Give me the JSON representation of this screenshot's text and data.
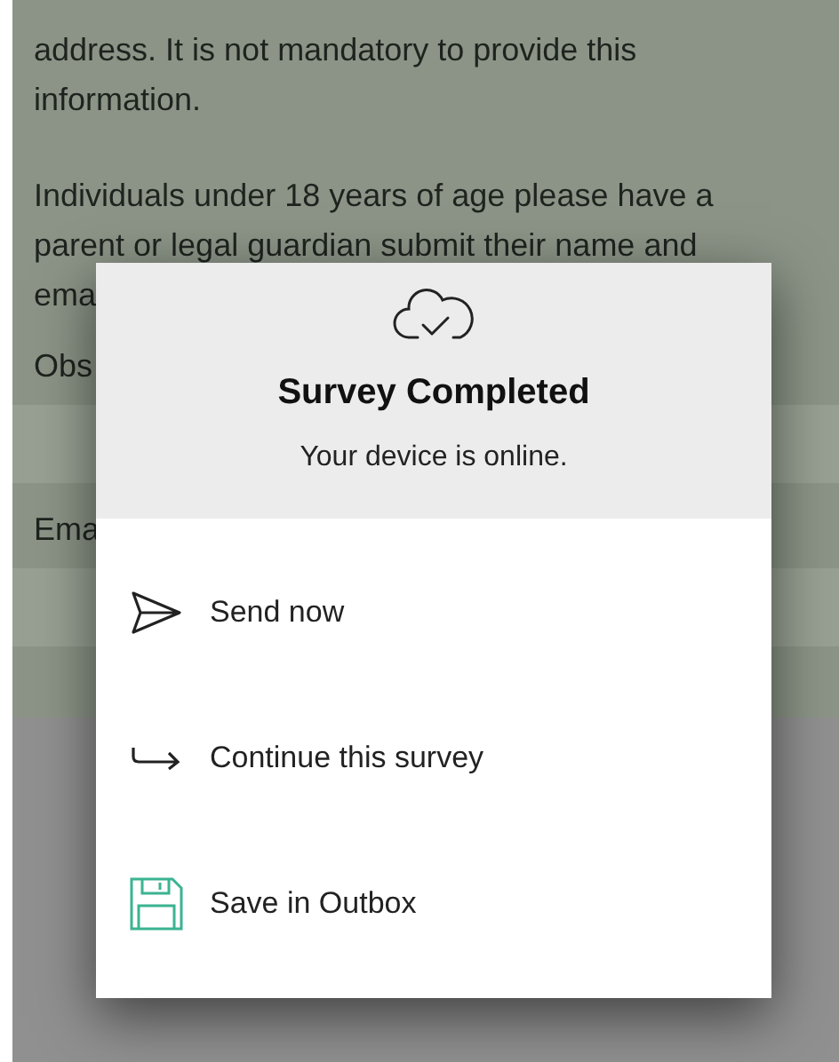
{
  "form_text": {
    "paragraphs": [
      [
        "address. It is not mandatory to provide this",
        "information."
      ],
      [
        "Individuals under 18 years of age please have a",
        "parent or legal guardian submit their name and",
        "ema"
      ]
    ]
  },
  "fields": [
    {
      "label": "Obs"
    },
    {
      "label": "Ema"
    }
  ],
  "dialog": {
    "title": "Survey Completed",
    "message": "Your device is online.",
    "actions": [
      {
        "kind": "send",
        "label": "Send now"
      },
      {
        "kind": "continue",
        "label": "Continue this survey"
      },
      {
        "kind": "save",
        "label": "Save in Outbox"
      }
    ]
  }
}
